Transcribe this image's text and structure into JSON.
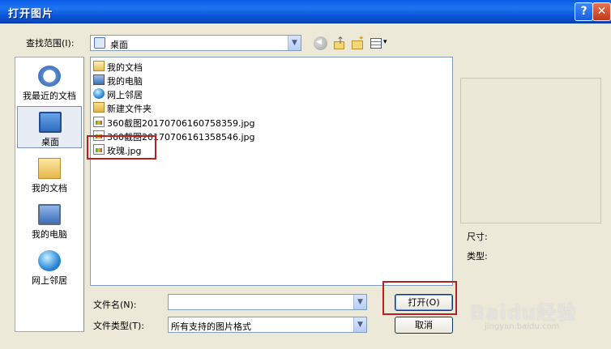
{
  "window": {
    "title": "打开图片",
    "help_label": "?",
    "close_label": "✕"
  },
  "lookin": {
    "label": "查找范围(I):",
    "value": "桌面"
  },
  "places": [
    {
      "label": "我最近的文档",
      "icon": "recent-documents-icon"
    },
    {
      "label": "桌面",
      "icon": "desktop-icon"
    },
    {
      "label": "我的文档",
      "icon": "my-documents-icon"
    },
    {
      "label": "我的电脑",
      "icon": "my-computer-icon"
    },
    {
      "label": "网上邻居",
      "icon": "network-places-icon"
    }
  ],
  "files": [
    {
      "name": "我的文档",
      "icon": "my-documents-icon"
    },
    {
      "name": "我的电脑",
      "icon": "my-computer-icon"
    },
    {
      "name": "网上邻居",
      "icon": "network-places-icon"
    },
    {
      "name": "新建文件夹",
      "icon": "folder-icon"
    },
    {
      "name": "360截图20170706160758359.jpg",
      "icon": "jpg-file-icon"
    },
    {
      "name": "360截图20170706161358546.jpg",
      "icon": "jpg-file-icon"
    },
    {
      "name": "玫瑰.jpg",
      "icon": "jpg-file-icon"
    }
  ],
  "preview": {
    "size_label": "尺寸:",
    "type_label": "类型:"
  },
  "filename": {
    "label": "文件名(N):",
    "value": ""
  },
  "filetype": {
    "label": "文件类型(T):",
    "value": "所有支持的图片格式"
  },
  "buttons": {
    "open": "打开(O)",
    "cancel": "取消"
  },
  "watermark": {
    "text": "Baidu经验",
    "url": "jingyan.baidu.com"
  },
  "colors": {
    "titlebar": "#0a5ce6",
    "dialog_bg": "#ece9d8",
    "highlight": "#b22222"
  }
}
